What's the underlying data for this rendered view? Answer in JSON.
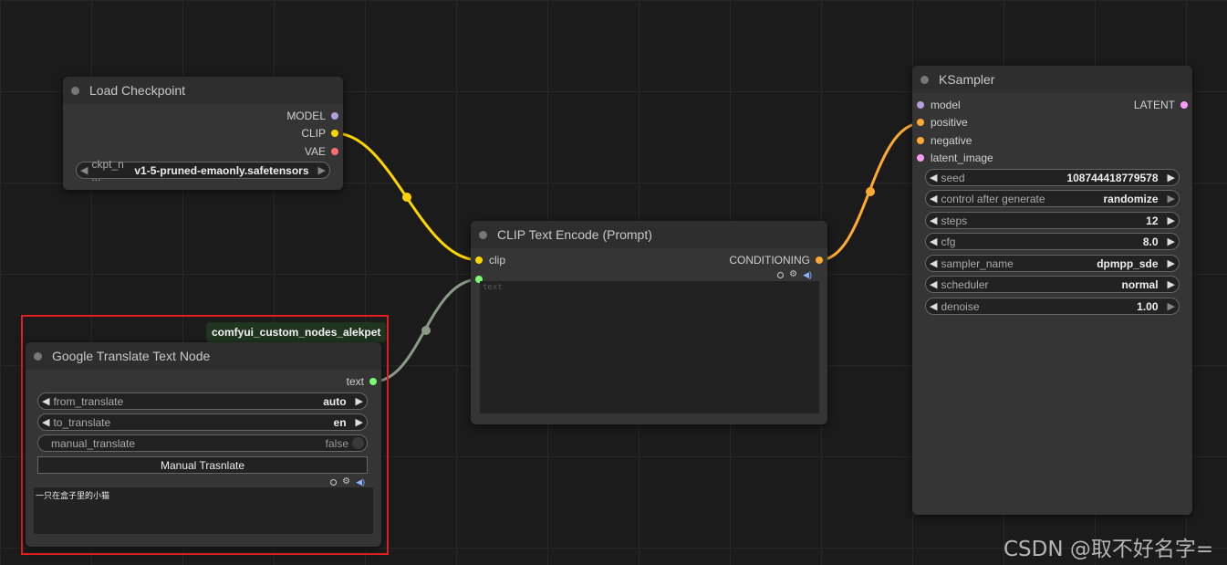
{
  "colors": {
    "model": "#b39ddb",
    "clip": "#ffd500",
    "vae": "#ff6e6e",
    "conditioning": "#ffa931",
    "latent": "#ff9cf9",
    "text_string": "#7cfc72",
    "highlight": "#e02020"
  },
  "load_checkpoint": {
    "title": "Load Checkpoint",
    "outputs": [
      "MODEL",
      "CLIP",
      "VAE"
    ],
    "ckpt_label": "ckpt_n ...",
    "ckpt_value": "v1-5-pruned-emaonly.safetensors"
  },
  "clip_encode": {
    "title": "CLIP Text Encode (Prompt)",
    "input_clip": "clip",
    "output": "CONDITIONING",
    "text_placeholder": "text"
  },
  "ksampler": {
    "title": "KSampler",
    "inputs": [
      "model",
      "positive",
      "negative",
      "latent_image"
    ],
    "output": "LATENT",
    "widgets": [
      {
        "label": "seed",
        "value": "108744418779578"
      },
      {
        "label": "control after generate",
        "value": "randomize"
      },
      {
        "label": "steps",
        "value": "12"
      },
      {
        "label": "cfg",
        "value": "8.0"
      },
      {
        "label": "sampler_name",
        "value": "dpmpp_sde"
      },
      {
        "label": "scheduler",
        "value": "normal"
      },
      {
        "label": "denoise",
        "value": "1.00"
      }
    ]
  },
  "translate_node": {
    "badge": "comfyui_custom_nodes_alekpet",
    "title": "Google Translate Text Node",
    "output": "text",
    "from_label": "from_translate",
    "from_value": "auto",
    "to_label": "to_translate",
    "to_value": "en",
    "manual_label": "manual_translate",
    "manual_value": "false",
    "button_label": "Manual Trasnlate",
    "text_value": "一只在盒子里的小猫"
  },
  "watermark": "CSDN @取不好名字="
}
